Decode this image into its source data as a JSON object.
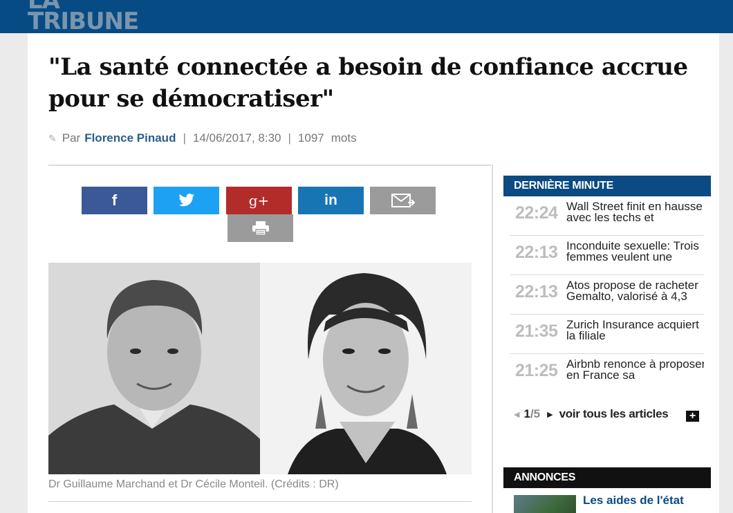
{
  "header": {
    "logo_text": "LA TRIBUNE",
    "brand_color": "#064b84"
  },
  "article": {
    "title": "\"La santé connectée a besoin de confiance accrue pour se démocratiser\"",
    "byline": {
      "prefix": "Par",
      "author": "Florence Pinaud",
      "date": "14/06/2017, 8:30",
      "word_count": "1097",
      "word_unit": "mots"
    },
    "image_caption": "Dr Guillaume Marchand et Dr Cécile Monteil. (Crédits : DR)"
  },
  "share_buttons": [
    {
      "icon": "facebook-icon",
      "glyph": "f",
      "color": "#3b5998"
    },
    {
      "icon": "twitter-icon",
      "glyph": "",
      "color": "#1da1f2"
    },
    {
      "icon": "google-plus-icon",
      "glyph": "g+",
      "color": "#b22d2a"
    },
    {
      "icon": "linkedin-icon",
      "glyph": "in",
      "color": "#1775b4"
    },
    {
      "icon": "email-icon",
      "glyph": "",
      "color": "#9b9b9b"
    },
    {
      "icon": "print-icon",
      "glyph": "",
      "color": "#9b9b9b"
    }
  ],
  "derniere_minute": {
    "heading": "DERNIÈRE MINUTE",
    "items": [
      {
        "time": "22:24",
        "text": "Wall Street finit en hausse avec les techs et"
      },
      {
        "time": "22:13",
        "text": "Inconduite sexuelle: Trois femmes veulent une"
      },
      {
        "time": "22:13",
        "text": "Atos propose de racheter Gemalto, valorisé à 4,3"
      },
      {
        "time": "21:35",
        "text": "Zurich Insurance acquiert la filiale"
      },
      {
        "time": "21:25",
        "text": "Airbnb renonce à proposer en France sa"
      }
    ],
    "pager": {
      "current": "1",
      "total": "/5",
      "see_all": "voir tous les articles",
      "plus": "+"
    }
  },
  "annonces": {
    "heading": "ANNONCES",
    "items": [
      {
        "title": "Les aides de l'état"
      }
    ]
  }
}
